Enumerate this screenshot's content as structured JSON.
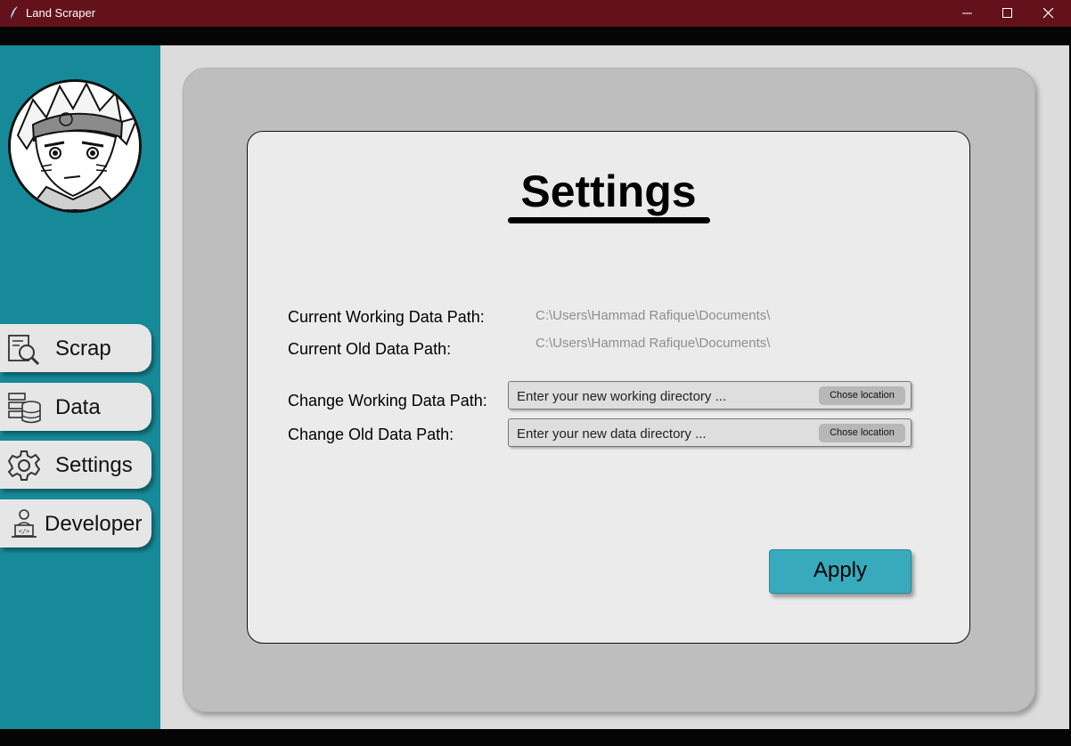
{
  "window": {
    "title": "Land Scraper",
    "controls": [
      "minimize-icon",
      "maximize-icon",
      "close-icon"
    ],
    "title_bar_color": "#63121b"
  },
  "sidebar": {
    "background_color": "#178a99",
    "items": [
      {
        "label": "Scrap",
        "icon": "magnifier-document-icon"
      },
      {
        "label": "Data",
        "icon": "database-icon"
      },
      {
        "label": "Settings",
        "icon": "gear-icon"
      },
      {
        "label": "Developer",
        "icon": "developer-icon"
      }
    ]
  },
  "settings": {
    "title": "Settings",
    "current_working_label": "Current Working Data Path:",
    "current_working_value": "C:\\Users\\Hammad Rafique\\Documents\\",
    "current_old_label": "Current Old Data Path:",
    "current_old_value": "C:\\Users\\Hammad Rafique\\Documents\\",
    "change_working_label": "Change Working Data Path:",
    "change_working_placeholder": "Enter your new working directory ...",
    "change_old_label": "Change Old Data Path:",
    "change_old_placeholder": "Enter your new data directory ...",
    "choose_label": "Chose location",
    "apply_label": "Apply",
    "accent_color": "#37aabb"
  }
}
